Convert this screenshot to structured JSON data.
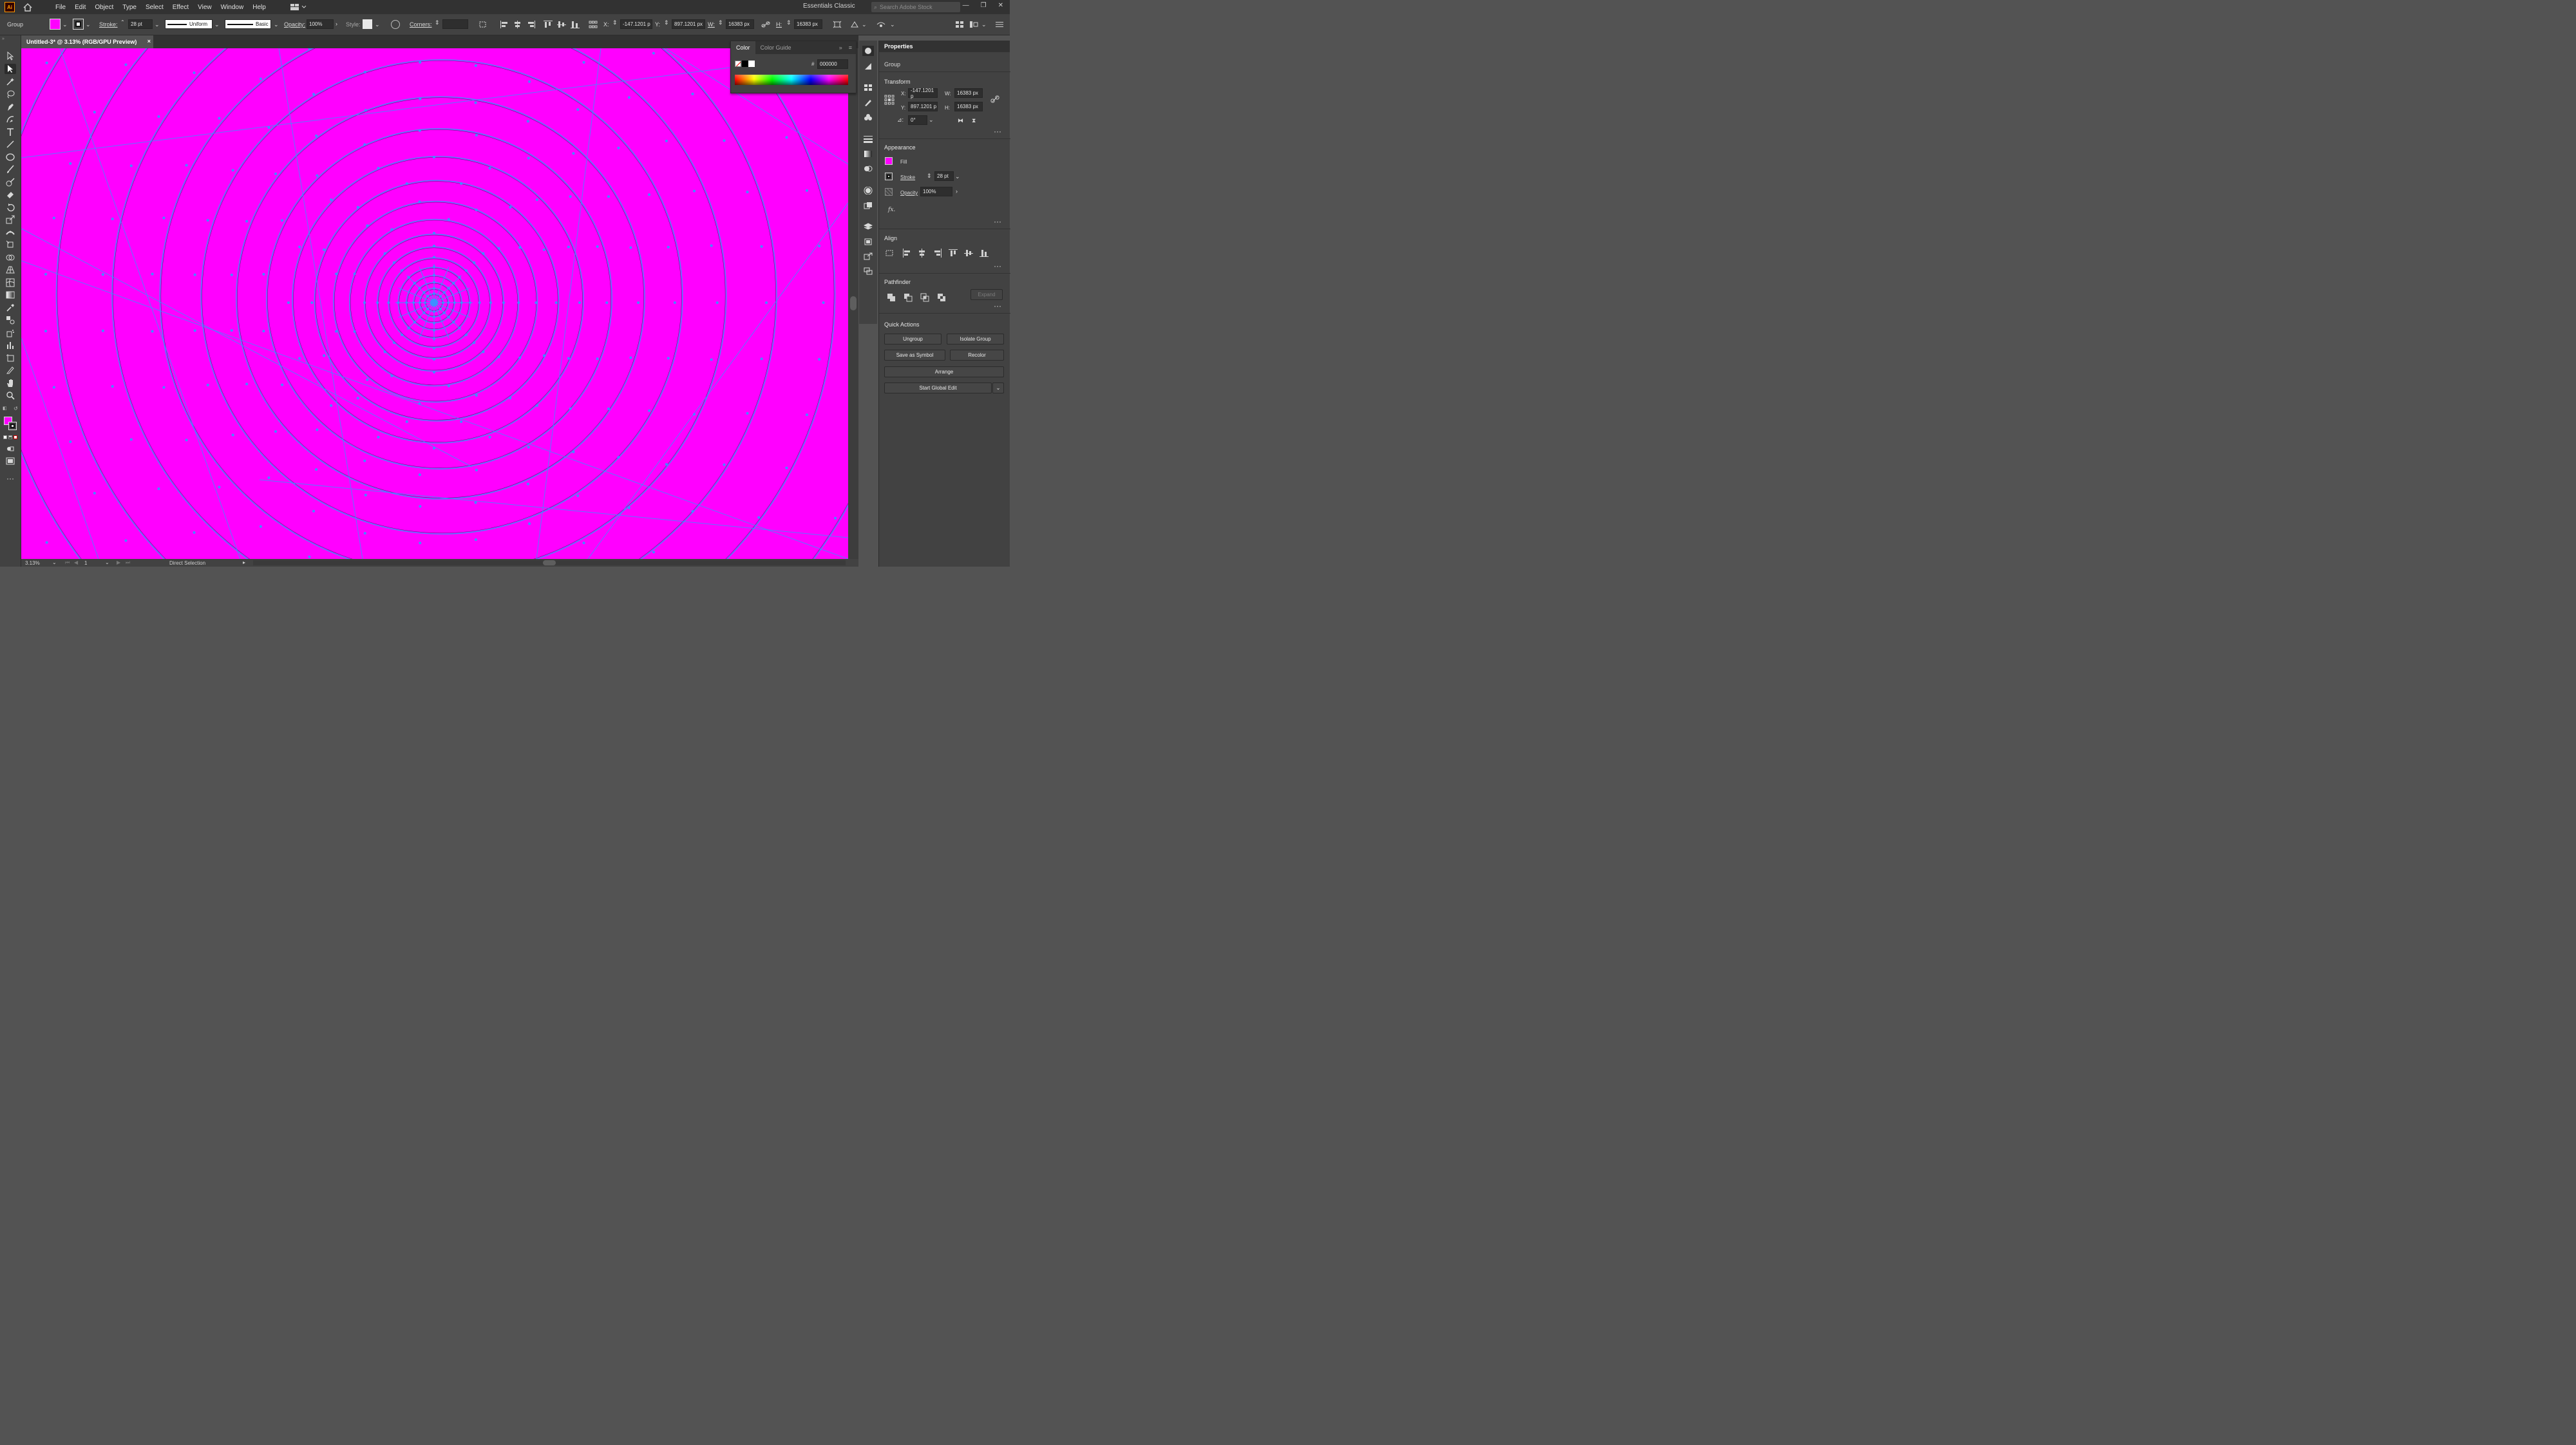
{
  "app": {
    "logo": "Ai",
    "workspace": "Essentials Classic",
    "search_placeholder": "Search Adobe Stock"
  },
  "menu": [
    "File",
    "Edit",
    "Object",
    "Type",
    "Select",
    "Effect",
    "View",
    "Window",
    "Help"
  ],
  "control_bar": {
    "selection_type": "Group",
    "stroke_label": "Stroke:",
    "stroke_value": "28 pt",
    "profile": "Uniform",
    "brush": "Basic",
    "opacity_label": "Opacity:",
    "opacity_value": "100%",
    "style_label": "Style:",
    "corners_label": "Corners:",
    "x_label": "X:",
    "x_value": "-147.1201 p",
    "y_label": "Y:",
    "y_value": "897.1201 px",
    "w_label": "W:",
    "w_value": "16383 px",
    "h_label": "H:",
    "h_value": "16383 px",
    "fill_color": "#ff00ff"
  },
  "document": {
    "tab_title": "Untitled-3* @ 3.13% (RGB/GPU Preview)",
    "close": "×"
  },
  "status_bar": {
    "zoom": "3.13%",
    "artboard": "1",
    "tool": "Direct Selection"
  },
  "color_panel": {
    "tabs": [
      "Color",
      "Color Guide"
    ],
    "hex_label": "#",
    "hex_value": "000000"
  },
  "properties": {
    "title": "Properties",
    "type": "Group",
    "transform": {
      "label": "Transform",
      "x": "-147.1201 p",
      "y": "897.1201 p",
      "w": "16383 px",
      "h": "16383 px",
      "angle": "0°"
    },
    "appearance": {
      "label": "Appearance",
      "fill": "Fill",
      "stroke": "Stroke",
      "stroke_value": "28 pt",
      "opacity": "Opacity",
      "opacity_value": "100%",
      "fx": "fx."
    },
    "align": {
      "label": "Align"
    },
    "pathfinder": {
      "label": "Pathfinder",
      "expand": "Expand"
    },
    "quick_actions": {
      "label": "Quick Actions",
      "ungroup": "Ungroup",
      "isolate": "Isolate Group",
      "symbol": "Save as Symbol",
      "recolor": "Recolor",
      "arrange": "Arrange",
      "global_edit": "Start Global Edit"
    }
  },
  "colors": {
    "artwork": "#ff00ff",
    "selection": "#3d8fff",
    "ui_dark": "#323232",
    "ui_mid": "#424242"
  }
}
